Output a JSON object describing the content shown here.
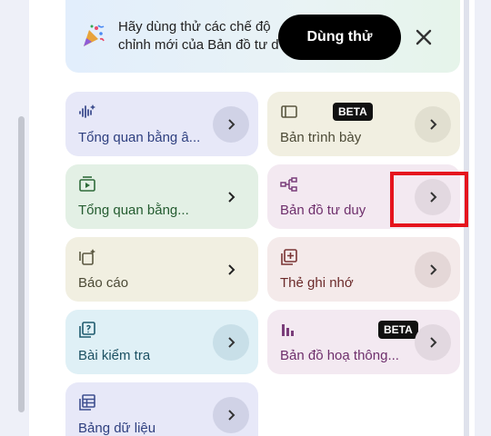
{
  "banner": {
    "line1": "Hãy dùng thử các chế độ",
    "line2": "chỉnh mới của Bản đồ tư d",
    "try_button": "Dùng thử"
  },
  "cards": [
    {
      "label": "Tổng quan bằng â...",
      "icon": "audio-sparkle-icon"
    },
    {
      "label": "Bản trình bày",
      "icon": "slides-icon",
      "badge": "BETA"
    },
    {
      "label": "Tổng quan bằng...",
      "icon": "video-play-icon"
    },
    {
      "label": "Bản đồ tư duy",
      "icon": "mind-map-icon"
    },
    {
      "label": "Báo cáo",
      "icon": "report-sparkle-icon"
    },
    {
      "label": "Thẻ ghi nhớ",
      "icon": "flashcard-icon"
    },
    {
      "label": "Bài kiểm tra",
      "icon": "quiz-icon"
    },
    {
      "label": "Bản đồ hoạ thông...",
      "icon": "infographic-icon",
      "badge": "BETA"
    },
    {
      "label": "Bảng dữ liệu",
      "icon": "data-table-icon"
    }
  ]
}
